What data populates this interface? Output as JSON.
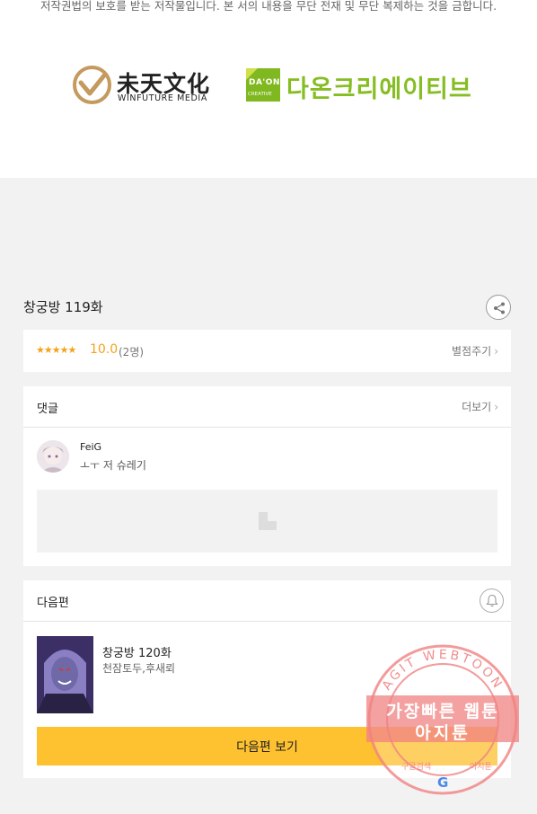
{
  "copyright": "저작권법의 보호를 받는 저작물입니다. 본 서의 내용을 무단 전재 및 무단 복제하는 것을 금합니다.",
  "logos": {
    "winfuture_cn": "未天文化",
    "winfuture_en": "WINFUTURE MEDIA",
    "daon_box_top": "DA'ON",
    "daon_box_bottom": "CREATIVE",
    "daon_ko": "다온크리에이티브"
  },
  "episode": {
    "title": "창궁방 119화"
  },
  "rating": {
    "stars": "★★★★★",
    "value": "10.0",
    "count": "(2명)",
    "rate_link": "별점주기"
  },
  "comments": {
    "title": "댓글",
    "more": "더보기",
    "items": [
      {
        "user": "FeiG",
        "text": "ㅗㅜ 저 슈레기"
      }
    ]
  },
  "next_episode": {
    "section_title": "다음편",
    "title": "창궁방 120화",
    "authors": "천잠토두,후새뢰",
    "button": "다음편 보기"
  },
  "watermark": {
    "ring": "AGIT WEBTOON",
    "line1": "가장빠른 웹툰",
    "line2": "아지툰",
    "bottom_left": "구글검색",
    "bottom_right": "아지툰"
  },
  "colors": {
    "accent": "#fec12f",
    "star": "#f3a31b",
    "daon_green": "#86bd22",
    "watermark": "#f08282"
  },
  "icons": {
    "share": "share-icon",
    "bell": "bell-icon",
    "chevron": "chevron-right-icon"
  }
}
